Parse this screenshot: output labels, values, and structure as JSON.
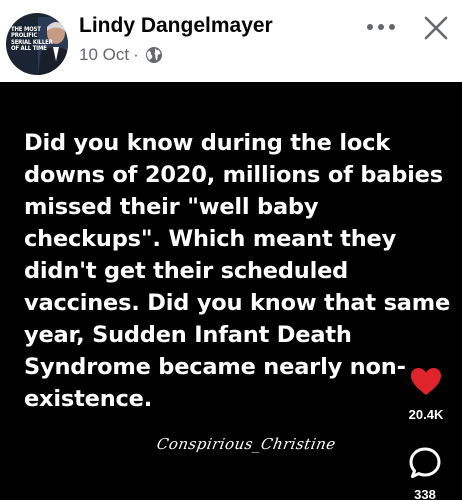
{
  "header": {
    "avatar_text": "THE MOST PROLIFIC SERIAL KILLER OF ALL TIME",
    "author_name": "Lindy Dangelmayer",
    "date": "10 Oct",
    "separator": "·",
    "audience_icon": "globe-icon",
    "more_icon": "more-options-icon",
    "close_icon": "close-icon"
  },
  "post": {
    "text": "Did you know during the lock downs of 2020, millions of babies missed their \"well baby checkups\". Which meant they didn't get their scheduled vaccines. Did you know that same year, Sudden Infant Death Syndrome became nearly non-existence.",
    "signature": "Conspirious_Christine",
    "background_color": "#000000",
    "text_color": "#ffffff"
  },
  "actions": {
    "like_icon": "heart-icon",
    "like_color": "#e0242b",
    "like_count": "20.4K",
    "comment_icon": "comment-icon",
    "comment_count": "338"
  }
}
